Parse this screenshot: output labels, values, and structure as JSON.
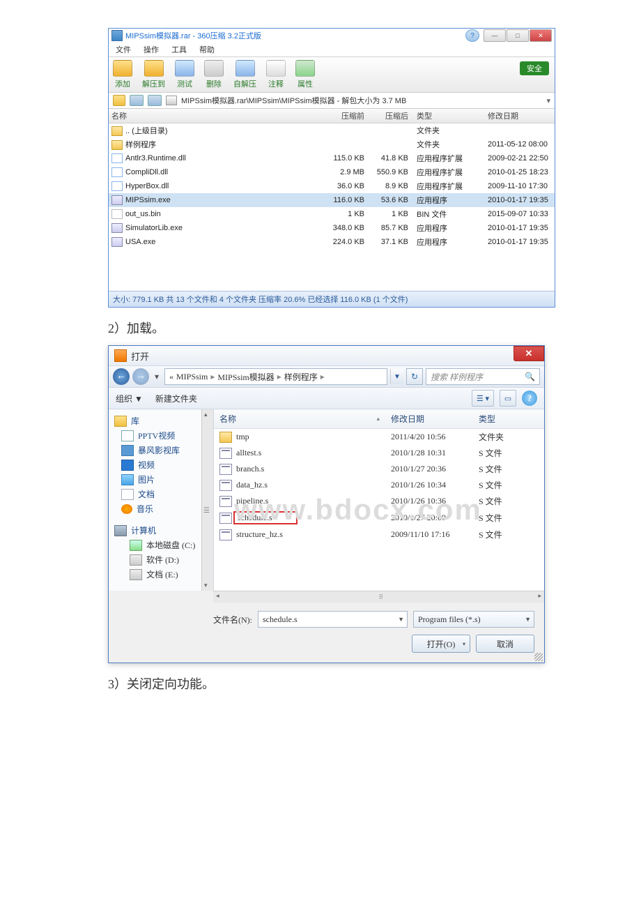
{
  "archive": {
    "title": "MIPSsim模拟器.rar - 360压缩 3.2正式版",
    "menus": [
      "文件",
      "操作",
      "工具",
      "帮助"
    ],
    "tools": [
      {
        "label": "添加",
        "color": "linear-gradient(#ffe08a,#f0b030)"
      },
      {
        "label": "解压到",
        "color": "linear-gradient(#ffe08a,#f0b030)"
      },
      {
        "label": "测试",
        "color": "linear-gradient(#cfe8ff,#8ab4e8)"
      },
      {
        "label": "删除",
        "color": "linear-gradient(#eee,#ccc)"
      },
      {
        "label": "自解压",
        "color": "linear-gradient(#cfe8ff,#8ab4e8)"
      },
      {
        "label": "注释",
        "color": "linear-gradient(#fff,#ddd)"
      },
      {
        "label": "属性",
        "color": "linear-gradient(#cfe8cf,#8ad48a)"
      }
    ],
    "safe": "安全",
    "path": "MIPSsim模拟器.rar\\MIPSsim\\MIPSsim模拟器 - 解包大小为 3.7 MB",
    "columns": {
      "name": "名称",
      "before": "压缩前",
      "after": "压缩后",
      "type": "类型",
      "date": "修改日期"
    },
    "rows": [
      {
        "icon": "i-folder",
        "name": ".. (上级目录)",
        "before": "",
        "after": "",
        "type": "文件夹",
        "date": ""
      },
      {
        "icon": "i-folder",
        "name": "样例程序",
        "before": "",
        "after": "",
        "type": "文件夹",
        "date": "2011-05-12 08:00"
      },
      {
        "icon": "i-dll",
        "name": "Antlr3.Runtime.dll",
        "before": "115.0 KB",
        "after": "41.8 KB",
        "type": "应用程序扩展",
        "date": "2009-02-21 22:50"
      },
      {
        "icon": "i-dll",
        "name": "CompliDll.dll",
        "before": "2.9 MB",
        "after": "550.9 KB",
        "type": "应用程序扩展",
        "date": "2010-01-25 18:23"
      },
      {
        "icon": "i-dll",
        "name": "HyperBox.dll",
        "before": "36.0 KB",
        "after": "8.9 KB",
        "type": "应用程序扩展",
        "date": "2009-11-10 17:30"
      },
      {
        "icon": "i-exe",
        "name": "MIPSsim.exe",
        "before": "116.0 KB",
        "after": "53.6 KB",
        "type": "应用程序",
        "date": "2010-01-17 19:35",
        "sel": true
      },
      {
        "icon": "i-bin",
        "name": "out_us.bin",
        "before": "1 KB",
        "after": "1 KB",
        "type": "BIN 文件",
        "date": "2015-09-07 10:33"
      },
      {
        "icon": "i-exe",
        "name": "SimulatorLib.exe",
        "before": "348.0 KB",
        "after": "85.7 KB",
        "type": "应用程序",
        "date": "2010-01-17 19:35"
      },
      {
        "icon": "i-exe",
        "name": "USA.exe",
        "before": "224.0 KB",
        "after": "37.1 KB",
        "type": "应用程序",
        "date": "2010-01-17 19:35"
      }
    ],
    "status": "大小: 779.1 KB 共 13 个文件和 4 个文件夹 压缩率 20.6% 已经选择 116.0 KB (1 个文件)"
  },
  "caption2": "2）加载。",
  "caption3": "3）关闭定向功能。",
  "open": {
    "title": "打开",
    "breadcrumb": [
      "MIPSsim",
      "MIPSsim模拟器",
      "样例程序"
    ],
    "search_placeholder": "搜索 样例程序",
    "toolbar": {
      "organize": "组织 ▼",
      "newfolder": "新建文件夹"
    },
    "sidebar": {
      "lib": "库",
      "items": [
        {
          "icon": "i-pptv",
          "label": "PPTV视频"
        },
        {
          "icon": "i-bf",
          "label": "暴风影视库"
        },
        {
          "icon": "i-vid",
          "label": "视频"
        },
        {
          "icon": "i-img",
          "label": "图片"
        },
        {
          "icon": "i-doc",
          "label": "文档"
        },
        {
          "icon": "i-mus",
          "label": "音乐"
        }
      ],
      "computer": "计算机",
      "drives": [
        {
          "icon": "i-drvc",
          "label": "本地磁盘 (C:)"
        },
        {
          "icon": "i-drv",
          "label": "软件 (D:)"
        },
        {
          "icon": "i-drv",
          "label": "文档 (E:)"
        }
      ]
    },
    "columns": {
      "name": "名称",
      "date": "修改日期",
      "type": "类型"
    },
    "files": [
      {
        "icon": "i-fold",
        "name": "tmp",
        "date": "2011/4/20 10:56",
        "type": "文件夹"
      },
      {
        "icon": "i-s",
        "name": "alltest.s",
        "date": "2010/1/28 10:31",
        "type": "S 文件"
      },
      {
        "icon": "i-s",
        "name": "branch.s",
        "date": "2010/1/27 20:36",
        "type": "S 文件"
      },
      {
        "icon": "i-s",
        "name": "data_hz.s",
        "date": "2010/1/26 10:34",
        "type": "S 文件"
      },
      {
        "icon": "i-s",
        "name": "pipeline.s",
        "date": "2010/1/26 10:36",
        "type": "S 文件"
      },
      {
        "icon": "i-s",
        "name": "schedule.s",
        "date": "2010/1/27 20:09",
        "type": "S 文件",
        "hl": true
      },
      {
        "icon": "i-s",
        "name": "structure_hz.s",
        "date": "2009/11/10 17:16",
        "type": "S 文件"
      }
    ],
    "filename_label": "文件名(N):",
    "filename_value": "schedule.s",
    "filter": "Program files (*.s)",
    "open_btn": "打开(O)",
    "cancel_btn": "取消",
    "watermark": "www.bdocx.com"
  }
}
